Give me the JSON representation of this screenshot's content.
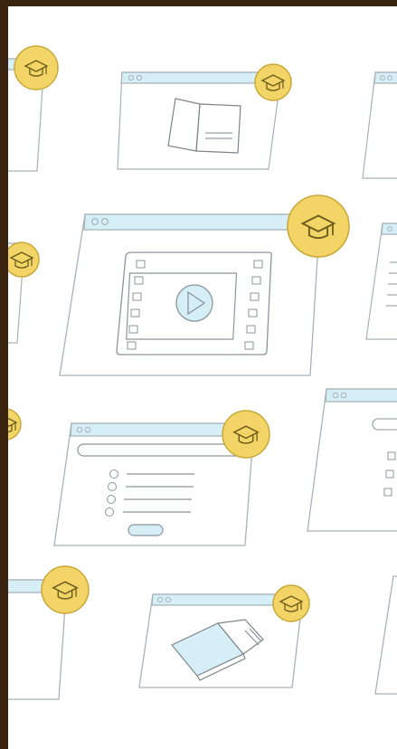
{
  "image": {
    "subject": "online-education-pattern",
    "colors": {
      "frame": "#3a2410",
      "background": "#ffffff",
      "line": "#a8b2b8",
      "window_bar": "#d6eef6",
      "badge": "#f2d566",
      "badge_stroke": "#c9a83a",
      "accent_fill": "#d6eef6"
    },
    "icons": [
      "graduation-cap-icon",
      "open-book-icon",
      "video-player-icon",
      "play-icon",
      "quiz-list-icon",
      "closed-book-icon",
      "document-lines-icon",
      "checkbox-list-icon"
    ]
  }
}
